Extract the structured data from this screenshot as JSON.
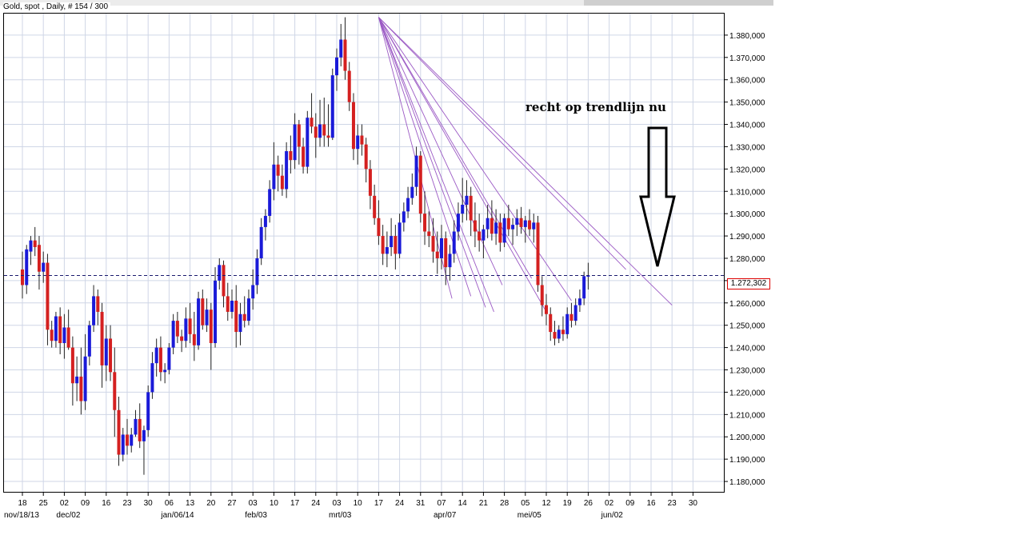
{
  "header": {
    "title": "Gold, spot , Daily, # 154 / 300"
  },
  "annotation": {
    "text": "recht op trendlijn nu"
  },
  "current_price_label": "1.272,302",
  "colors": {
    "up": "#1a1ad8",
    "down": "#d42020",
    "fan": "#9b59c4",
    "priceline": "#1a1a6e",
    "grid": "#cfd6e6"
  },
  "chart_data": {
    "type": "candlestick",
    "title": "Gold, spot , Daily",
    "ylim": [
      1175000,
      1390000
    ],
    "ytick_values": [
      1180000,
      1190000,
      1200000,
      1210000,
      1220000,
      1230000,
      1240000,
      1250000,
      1260000,
      1270000,
      1280000,
      1290000,
      1300000,
      1310000,
      1320000,
      1330000,
      1340000,
      1350000,
      1360000,
      1370000,
      1380000
    ],
    "ytick_labels": [
      "1.180,000",
      "1.190,000",
      "1.200,000",
      "1.210,000",
      "1.220,000",
      "1.230,000",
      "1.240,000",
      "1.250,000",
      "1.260,000",
      "1.270,000",
      "1.280,000",
      "1.290,000",
      "1.300,000",
      "1.310,000",
      "1.320,000",
      "1.330,000",
      "1.340,000",
      "1.350,000",
      "1.360,000",
      "1.370,000",
      "1.380,000"
    ],
    "x_day_labels": [
      "18",
      "25",
      "02",
      "09",
      "16",
      "23",
      "30",
      "06",
      "13",
      "20",
      "27",
      "03",
      "10",
      "17",
      "24",
      "03",
      "10",
      "17",
      "24",
      "31",
      "07",
      "14",
      "21",
      "28",
      "05",
      "12",
      "19",
      "26",
      "02",
      "09",
      "16",
      "23",
      "30"
    ],
    "x_month_labels": [
      {
        "label": "nov/18/13",
        "at_week": 0
      },
      {
        "label": "dec/02",
        "at_week": 2
      },
      {
        "label": "jan/06/14",
        "at_week": 7
      },
      {
        "label": "feb/03",
        "at_week": 11
      },
      {
        "label": "mrt/03",
        "at_week": 15
      },
      {
        "label": "apr/07",
        "at_week": 20
      },
      {
        "label": "mei/05",
        "at_week": 24
      },
      {
        "label": "jun/02",
        "at_week": 28
      }
    ],
    "current_price": 1272302,
    "peak": {
      "week": 17,
      "price": 1388000
    },
    "fan_targets": [
      [
        20.5,
        1262000
      ],
      [
        21.4,
        1263000
      ],
      [
        22.1,
        1258000
      ],
      [
        22.5,
        1256000
      ],
      [
        22.9,
        1268000
      ],
      [
        24.3,
        1271000
      ],
      [
        25.0,
        1256000
      ],
      [
        26.2,
        1261000
      ],
      [
        28.8,
        1275000
      ],
      [
        31.0,
        1259000
      ]
    ],
    "ohlc": [
      [
        0.0,
        1275000,
        1283000,
        1262000,
        1268000
      ],
      [
        0.2,
        1268000,
        1286000,
        1264000,
        1284000
      ],
      [
        0.4,
        1283000,
        1290000,
        1277000,
        1288000
      ],
      [
        0.6,
        1288000,
        1294000,
        1281000,
        1285000
      ],
      [
        0.8,
        1286000,
        1290000,
        1266000,
        1274000
      ],
      [
        1.0,
        1274000,
        1283000,
        1269000,
        1278000
      ],
      [
        1.2,
        1278000,
        1282000,
        1241000,
        1248000
      ],
      [
        1.4,
        1248000,
        1252000,
        1240000,
        1243000
      ],
      [
        1.6,
        1243000,
        1256000,
        1240000,
        1254000
      ],
      [
        1.8,
        1254000,
        1258000,
        1237000,
        1242000
      ],
      [
        2.0,
        1242000,
        1255000,
        1235000,
        1249000
      ],
      [
        2.2,
        1249000,
        1257000,
        1239000,
        1240000
      ],
      [
        2.4,
        1240000,
        1245000,
        1214000,
        1224000
      ],
      [
        2.6,
        1224000,
        1236000,
        1216000,
        1227000
      ],
      [
        2.8,
        1227000,
        1240000,
        1210000,
        1216000
      ],
      [
        3.0,
        1216000,
        1246000,
        1212000,
        1236000
      ],
      [
        3.2,
        1236000,
        1252000,
        1232000,
        1250000
      ],
      [
        3.4,
        1250000,
        1268000,
        1247000,
        1263000
      ],
      [
        3.6,
        1263000,
        1266000,
        1250000,
        1256000
      ],
      [
        3.8,
        1256000,
        1260000,
        1222000,
        1232000
      ],
      [
        4.0,
        1232000,
        1250000,
        1225000,
        1244000
      ],
      [
        4.2,
        1244000,
        1250000,
        1225000,
        1229000
      ],
      [
        4.4,
        1229000,
        1240000,
        1200000,
        1212000
      ],
      [
        4.6,
        1212000,
        1218000,
        1187000,
        1192000
      ],
      [
        4.8,
        1192000,
        1204000,
        1189000,
        1201000
      ],
      [
        5.0,
        1201000,
        1208000,
        1192000,
        1196000
      ],
      [
        5.2,
        1196000,
        1204000,
        1193000,
        1201000
      ],
      [
        5.4,
        1201000,
        1212000,
        1200000,
        1208000
      ],
      [
        5.6,
        1208000,
        1215000,
        1195000,
        1198000
      ],
      [
        5.8,
        1198000,
        1205000,
        1183000,
        1203000
      ],
      [
        6.0,
        1203000,
        1223000,
        1200000,
        1220000
      ],
      [
        6.2,
        1220000,
        1238000,
        1217000,
        1233000
      ],
      [
        6.4,
        1233000,
        1244000,
        1227000,
        1240000
      ],
      [
        6.6,
        1240000,
        1245000,
        1225000,
        1229000
      ],
      [
        6.8,
        1229000,
        1233000,
        1224000,
        1230000
      ],
      [
        7.0,
        1230000,
        1242000,
        1228000,
        1240000
      ],
      [
        7.2,
        1240000,
        1255000,
        1237000,
        1252000
      ],
      [
        7.4,
        1252000,
        1256000,
        1242000,
        1245000
      ],
      [
        7.6,
        1245000,
        1248000,
        1238000,
        1243000
      ],
      [
        7.8,
        1243000,
        1258000,
        1240000,
        1253000
      ],
      [
        8.0,
        1253000,
        1260000,
        1242000,
        1246000
      ],
      [
        8.2,
        1246000,
        1256000,
        1234000,
        1241000
      ],
      [
        8.4,
        1241000,
        1265000,
        1239000,
        1262000
      ],
      [
        8.6,
        1262000,
        1266000,
        1248000,
        1250000
      ],
      [
        8.8,
        1250000,
        1262000,
        1247000,
        1257000
      ],
      [
        9.0,
        1257000,
        1260000,
        1230000,
        1242000
      ],
      [
        9.2,
        1242000,
        1276000,
        1240000,
        1270000
      ],
      [
        9.4,
        1270000,
        1280000,
        1266000,
        1277000
      ],
      [
        9.6,
        1277000,
        1279000,
        1258000,
        1263000
      ],
      [
        9.8,
        1263000,
        1269000,
        1252000,
        1256000
      ],
      [
        10.0,
        1256000,
        1266000,
        1253000,
        1261000
      ],
      [
        10.2,
        1261000,
        1268000,
        1240000,
        1247000
      ],
      [
        10.4,
        1247000,
        1260000,
        1241000,
        1255000
      ],
      [
        10.6,
        1255000,
        1263000,
        1249000,
        1252000
      ],
      [
        10.8,
        1252000,
        1266000,
        1250000,
        1262000
      ],
      [
        11.0,
        1262000,
        1275000,
        1257000,
        1268000
      ],
      [
        11.2,
        1268000,
        1284000,
        1264000,
        1280000
      ],
      [
        11.4,
        1280000,
        1298000,
        1277000,
        1294000
      ],
      [
        11.6,
        1294000,
        1302000,
        1288000,
        1299000
      ],
      [
        11.8,
        1299000,
        1315000,
        1296000,
        1311000
      ],
      [
        12.0,
        1311000,
        1332000,
        1306000,
        1322000
      ],
      [
        12.2,
        1322000,
        1326000,
        1310000,
        1317000
      ],
      [
        12.4,
        1317000,
        1322000,
        1308000,
        1311000
      ],
      [
        12.6,
        1311000,
        1332000,
        1307000,
        1328000
      ],
      [
        12.8,
        1328000,
        1335000,
        1318000,
        1324000
      ],
      [
        13.0,
        1324000,
        1345000,
        1320000,
        1340000
      ],
      [
        13.2,
        1340000,
        1342000,
        1322000,
        1330000
      ],
      [
        13.4,
        1330000,
        1334000,
        1318000,
        1321000
      ],
      [
        13.6,
        1321000,
        1346000,
        1318000,
        1343000
      ],
      [
        13.8,
        1343000,
        1354000,
        1336000,
        1339000
      ],
      [
        14.0,
        1339000,
        1345000,
        1325000,
        1334000
      ],
      [
        14.2,
        1334000,
        1351000,
        1330000,
        1340000
      ],
      [
        14.4,
        1340000,
        1352000,
        1330000,
        1335000
      ],
      [
        14.6,
        1335000,
        1349000,
        1330000,
        1334000
      ],
      [
        14.8,
        1334000,
        1365000,
        1333000,
        1362000
      ],
      [
        15.0,
        1362000,
        1374000,
        1355000,
        1370000
      ],
      [
        15.2,
        1370000,
        1385000,
        1366000,
        1378000
      ],
      [
        15.4,
        1378000,
        1388000,
        1360000,
        1364000
      ],
      [
        15.6,
        1364000,
        1368000,
        1346000,
        1350000
      ],
      [
        15.8,
        1350000,
        1354000,
        1324000,
        1329000
      ],
      [
        16.0,
        1329000,
        1340000,
        1322000,
        1335000
      ],
      [
        16.2,
        1335000,
        1340000,
        1326000,
        1331000
      ],
      [
        16.4,
        1331000,
        1334000,
        1314000,
        1320000
      ],
      [
        16.6,
        1320000,
        1324000,
        1302000,
        1308000
      ],
      [
        16.8,
        1308000,
        1313000,
        1295000,
        1298000
      ],
      [
        17.0,
        1298000,
        1306000,
        1286000,
        1290000
      ],
      [
        17.2,
        1290000,
        1295000,
        1277000,
        1282000
      ],
      [
        17.4,
        1282000,
        1292000,
        1276000,
        1285000
      ],
      [
        17.6,
        1285000,
        1298000,
        1281000,
        1290000
      ],
      [
        17.8,
        1290000,
        1295000,
        1275000,
        1282000
      ],
      [
        18.0,
        1282000,
        1300000,
        1280000,
        1296000
      ],
      [
        18.2,
        1296000,
        1305000,
        1292000,
        1301000
      ],
      [
        18.4,
        1301000,
        1312000,
        1298000,
        1307000
      ],
      [
        18.6,
        1307000,
        1318000,
        1304000,
        1312000
      ],
      [
        18.8,
        1312000,
        1330000,
        1308000,
        1326000
      ],
      [
        19.0,
        1326000,
        1328000,
        1296000,
        1300000
      ],
      [
        19.2,
        1300000,
        1310000,
        1286000,
        1292000
      ],
      [
        19.4,
        1292000,
        1301000,
        1285000,
        1290000
      ],
      [
        19.6,
        1290000,
        1298000,
        1278000,
        1283000
      ],
      [
        19.8,
        1283000,
        1292000,
        1273000,
        1280000
      ],
      [
        20.0,
        1280000,
        1295000,
        1275000,
        1289000
      ],
      [
        20.2,
        1289000,
        1292000,
        1268000,
        1276000
      ],
      [
        20.4,
        1276000,
        1286000,
        1270000,
        1282000
      ],
      [
        20.6,
        1282000,
        1297000,
        1278000,
        1292000
      ],
      [
        20.8,
        1292000,
        1305000,
        1288000,
        1300000
      ],
      [
        21.0,
        1300000,
        1316000,
        1296000,
        1304000
      ],
      [
        21.2,
        1304000,
        1315000,
        1297000,
        1308000
      ],
      [
        21.4,
        1308000,
        1312000,
        1290000,
        1297000
      ],
      [
        21.6,
        1297000,
        1305000,
        1285000,
        1292000
      ],
      [
        21.8,
        1292000,
        1300000,
        1283000,
        1288000
      ],
      [
        22.0,
        1288000,
        1295000,
        1280000,
        1293000
      ],
      [
        22.2,
        1293000,
        1304000,
        1289000,
        1298000
      ],
      [
        22.4,
        1298000,
        1306000,
        1288000,
        1291000
      ],
      [
        22.6,
        1291000,
        1302000,
        1286000,
        1296000
      ],
      [
        22.8,
        1296000,
        1300000,
        1283000,
        1287000
      ],
      [
        23.0,
        1287000,
        1300000,
        1285000,
        1298000
      ],
      [
        23.2,
        1298000,
        1304000,
        1290000,
        1293000
      ],
      [
        23.4,
        1293000,
        1298000,
        1286000,
        1295000
      ],
      [
        23.6,
        1295000,
        1302000,
        1290000,
        1298000
      ],
      [
        23.8,
        1298000,
        1303000,
        1291000,
        1294000
      ],
      [
        24.0,
        1294000,
        1299000,
        1287000,
        1297000
      ],
      [
        24.2,
        1297000,
        1302000,
        1290000,
        1293000
      ],
      [
        24.4,
        1293000,
        1300000,
        1287000,
        1296000
      ],
      [
        24.6,
        1296000,
        1299000,
        1265000,
        1268000
      ],
      [
        24.8,
        1268000,
        1272000,
        1254000,
        1259000
      ],
      [
        25.0,
        1259000,
        1264000,
        1250000,
        1255000
      ],
      [
        25.2,
        1255000,
        1258000,
        1243000,
        1247000
      ],
      [
        25.4,
        1247000,
        1252000,
        1241000,
        1244000
      ],
      [
        25.6,
        1244000,
        1250000,
        1242000,
        1248000
      ],
      [
        25.8,
        1248000,
        1254000,
        1243000,
        1246000
      ],
      [
        26.0,
        1246000,
        1258000,
        1244000,
        1255000
      ],
      [
        26.2,
        1255000,
        1260000,
        1249000,
        1252000
      ],
      [
        26.4,
        1252000,
        1262000,
        1250000,
        1259000
      ],
      [
        26.6,
        1259000,
        1266000,
        1256000,
        1262000
      ],
      [
        26.8,
        1262000,
        1274000,
        1259000,
        1272000
      ],
      [
        27.0,
        1272000,
        1278000,
        1266000,
        1272302
      ]
    ]
  }
}
